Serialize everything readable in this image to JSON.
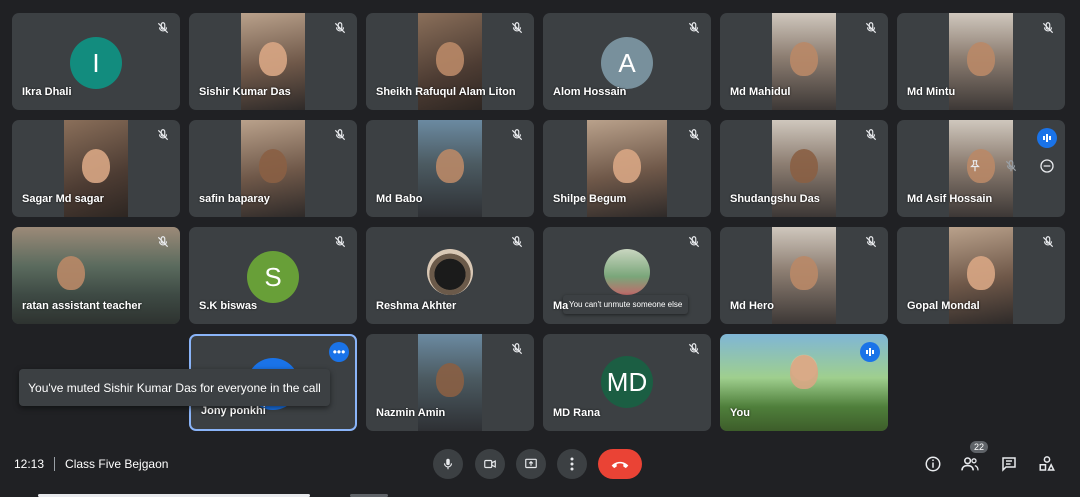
{
  "participants": [
    {
      "name": "Ikra Dhali",
      "kind": "avatar",
      "initial": "I",
      "avatar_color": "#128c7e"
    },
    {
      "name": "Sishir Kumar Das",
      "kind": "video"
    },
    {
      "name": "Sheikh Rafuqul Alam Liton",
      "kind": "video"
    },
    {
      "name": "Alom Hossain",
      "kind": "avatar",
      "initial": "A",
      "avatar_color": "#78909c"
    },
    {
      "name": "Md Mahidul",
      "kind": "video"
    },
    {
      "name": "Md Mintu",
      "kind": "video"
    },
    {
      "name": "Sagar Md sagar",
      "kind": "video"
    },
    {
      "name": "safin baparay",
      "kind": "video"
    },
    {
      "name": "Md Babo",
      "kind": "video"
    },
    {
      "name": "Shilpe Begum",
      "kind": "video"
    },
    {
      "name": "Shudangshu Das",
      "kind": "video"
    },
    {
      "name": "Md Asif Hossain",
      "kind": "video"
    },
    {
      "name": "ratan assistant teacher",
      "kind": "video"
    },
    {
      "name": "S.K biswas",
      "kind": "avatar",
      "initial": "S",
      "avatar_color": "#689f38"
    },
    {
      "name": "Reshma Akhter",
      "kind": "photo"
    },
    {
      "name": "Ma",
      "kind": "photo"
    },
    {
      "name": "Md Hero",
      "kind": "video"
    },
    {
      "name": "Gopal Mondal",
      "kind": "video"
    },
    {
      "name": "Jony ponkhi",
      "kind": "avatar"
    },
    {
      "name": "Nazmin Amin",
      "kind": "video"
    },
    {
      "name": "MD Rana",
      "kind": "avatar",
      "initial": "MD",
      "avatar_color": "#1b5e43"
    },
    {
      "name": "You",
      "kind": "video"
    }
  ],
  "tooltip_text": "You can't unmute someone else",
  "toast_text": "You've muted Sishir Kumar Das for everyone in the call",
  "meeting": {
    "time": "12:13",
    "title": "Class Five Bejgaon"
  },
  "people_count": "22",
  "colors": {
    "background": "#202124",
    "tile": "#3c4043",
    "accent": "#1a73e8",
    "end_call": "#ea4335"
  }
}
